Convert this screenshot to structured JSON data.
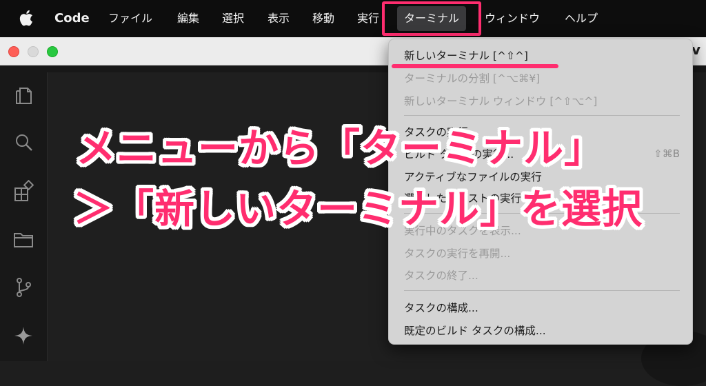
{
  "menubar": {
    "app_name": "Code",
    "items": [
      "ファイル",
      "編集",
      "選択",
      "表示",
      "移動",
      "実行",
      "ターミナル",
      "ウィンドウ",
      "ヘルプ"
    ],
    "active_item": "ターミナル"
  },
  "window": {
    "title_fragment": "v"
  },
  "activity_bar": {
    "icons": [
      "explorer-icon",
      "search-icon",
      "extensions-icon",
      "folder-icon",
      "source-control-icon",
      "sparkle-icon"
    ]
  },
  "terminal_menu": {
    "items": [
      {
        "label": "新しいターミナル [^⇧^]",
        "enabled": true
      },
      {
        "label": "ターミナルの分割 [^⌥⌘¥]",
        "enabled": false
      },
      {
        "label": "新しいターミナル ウィンドウ [^⇧⌥^]",
        "enabled": false
      },
      {
        "label": "タスクの実行...",
        "enabled": true
      },
      {
        "label": "ビルド タスクの実行...",
        "enabled": true,
        "shortcut": "⇧⌘B"
      },
      {
        "label": "アクティブなファイルの実行",
        "enabled": true
      },
      {
        "label": "選択したテキストの実行",
        "enabled": true
      },
      {
        "label": "実行中のタスクを表示...",
        "enabled": false
      },
      {
        "label": "タスクの実行を再開...",
        "enabled": false
      },
      {
        "label": "タスクの終了...",
        "enabled": false
      },
      {
        "label": "タスクの構成...",
        "enabled": true
      },
      {
        "label": "既定のビルド タスクの構成...",
        "enabled": true
      }
    ]
  },
  "caption": {
    "line1": "メニューから「ターミナル」",
    "line2": "＞「新しいターミナル」を選択"
  },
  "colors": {
    "highlight": "#ff2d6f",
    "menubar_bg": "#0d0d0d",
    "dropdown_bg": "#d4d4d4",
    "editor_bg": "#1f1f1f"
  }
}
